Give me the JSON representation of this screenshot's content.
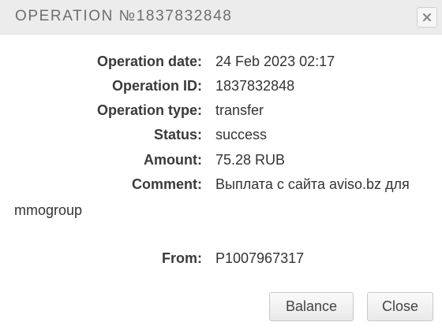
{
  "dialog": {
    "title": "OPERATION №1837832848",
    "close_icon": "close-x-icon"
  },
  "details": {
    "date_label": "Operation date:",
    "date_value": "24 Feb 2023 02:17",
    "id_label": "Operation ID:",
    "id_value": "1837832848",
    "type_label": "Operation type:",
    "type_value": "transfer",
    "status_label": "Status:",
    "status_value": "success",
    "amount_label": "Amount:",
    "amount_value": "75.28 RUB",
    "comment_label": "Comment:",
    "comment_value_line1": "Выплата с сайта aviso.bz для",
    "comment_value_line2": "mmogroup",
    "from_label": "From:",
    "from_value": "P1007967317"
  },
  "buttons": {
    "balance_label": "Balance",
    "close_label": "Close"
  }
}
